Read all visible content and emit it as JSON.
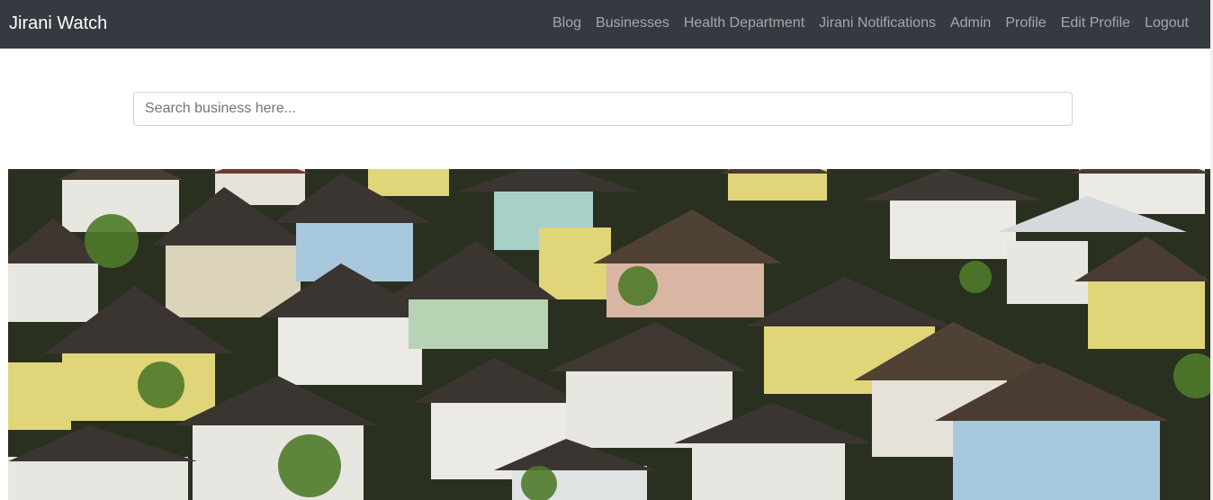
{
  "navbar": {
    "brand": "Jirani Watch",
    "links": [
      {
        "label": "Blog"
      },
      {
        "label": "Businesses"
      },
      {
        "label": "Health Department"
      },
      {
        "label": "Jirani Notifications"
      },
      {
        "label": "Admin"
      },
      {
        "label": "Profile"
      },
      {
        "label": "Edit Profile"
      },
      {
        "label": "Logout"
      }
    ],
    "colors": {
      "background": "#343a40",
      "brand": "#ffffff",
      "link": "#9a9da0"
    }
  },
  "search": {
    "placeholder": "Search business here...",
    "value": ""
  },
  "hero": {
    "subject": "aerial view of a dense neighborhood of houses",
    "palette": {
      "roof_dark": "#3b3531",
      "roof_brown": "#5a4638",
      "wall_white": "#e8e6e1",
      "wall_yellow": "#e1d579",
      "wall_green": "#b7d3b4",
      "wall_pink": "#d8b6a3",
      "wall_blue": "#a8c8dd",
      "foliage": "#4f7a2a"
    }
  }
}
